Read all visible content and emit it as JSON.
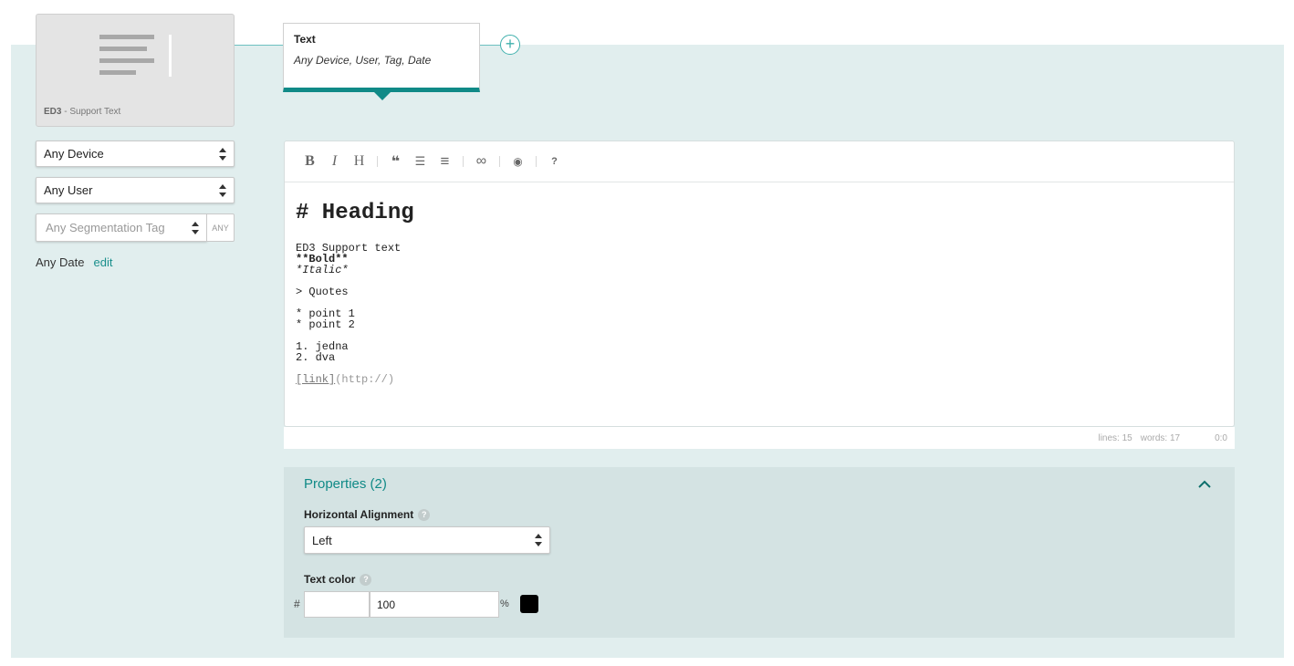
{
  "thumbnail": {
    "code": "ED3",
    "label": " - Support Text"
  },
  "filters": {
    "device": "Any Device",
    "user": "Any User",
    "tag_placeholder": "Any Segmentation Tag",
    "tag_button": "ANY",
    "date": "Any Date",
    "date_edit": "edit"
  },
  "card": {
    "title": "Text",
    "subtitle": "Any Device, User, Tag, Date"
  },
  "add_icon": "plus-circle-icon",
  "toolbar": [
    {
      "name": "bold-button",
      "glyph": "B"
    },
    {
      "name": "italic-button",
      "glyph": "I"
    },
    {
      "name": "heading-button",
      "glyph": "H"
    },
    {
      "name": "quote-button",
      "glyph": "❝"
    },
    {
      "name": "unordered-list-button",
      "glyph": "☰"
    },
    {
      "name": "ordered-list-button",
      "glyph": "≡"
    },
    {
      "name": "link-button",
      "glyph": "∞"
    },
    {
      "name": "preview-button",
      "glyph": "◉"
    },
    {
      "name": "help-button",
      "glyph": "?"
    }
  ],
  "editor": {
    "heading": "# Heading",
    "line1": "ED3 Support text",
    "bold": "**Bold**",
    "italic": "*Italic*",
    "quote": "> Quotes",
    "point1": "* point 1",
    "point2": "* point 2",
    "ol1": "1. jedna",
    "ol2": "2. dva",
    "link_text": "[link]",
    "link_url": "(http://)"
  },
  "status": {
    "lines": "lines: 15",
    "words": "words: 17",
    "cursor": "0:0"
  },
  "properties": {
    "title": "Properties (2)",
    "h_align_label": "Horizontal Alignment",
    "h_align_value": "Left",
    "text_color_label": "Text color",
    "hash": "#",
    "hex_value": "",
    "opacity": "100",
    "pct": "%",
    "swatch_color": "#000000"
  }
}
